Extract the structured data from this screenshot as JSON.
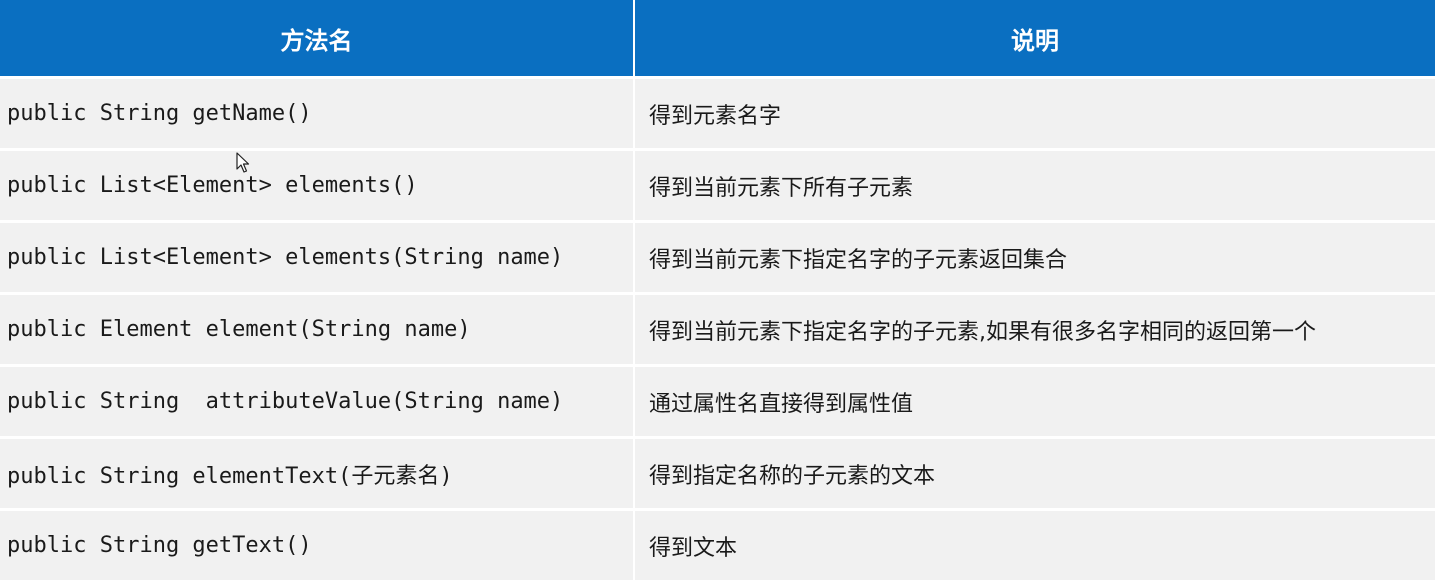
{
  "table": {
    "headers": [
      "方法名",
      "说明"
    ],
    "rows": [
      {
        "method": "public String getName()",
        "desc": "得到元素名字"
      },
      {
        "method": "public List<Element> elements()",
        "desc": "得到当前元素下所有子元素"
      },
      {
        "method": "public List<Element> elements(String name)",
        "desc": "得到当前元素下指定名字的子元素返回集合"
      },
      {
        "method": "public Element element(String name)",
        "desc": "得到当前元素下指定名字的子元素,如果有很多名字相同的返回第一个"
      },
      {
        "method": "public String  attributeValue(String name)",
        "desc": "通过属性名直接得到属性值"
      },
      {
        "method": "public String elementText(子元素名)",
        "desc": "得到指定名称的子元素的文本"
      },
      {
        "method": "public String getText()",
        "desc": "得到文本"
      }
    ]
  },
  "colors": {
    "header_bg": "#0a6fc1",
    "header_text": "#ffffff",
    "row_bg": "#f1f1f1",
    "divider": "#ffffff"
  },
  "icons": {
    "cursor": "mouse-pointer-icon"
  }
}
